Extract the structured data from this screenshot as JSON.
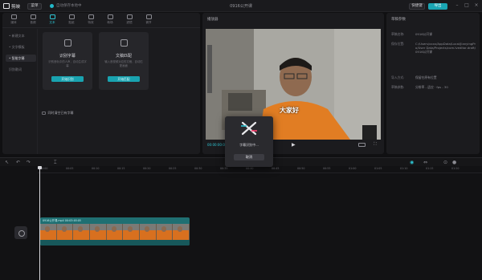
{
  "app": {
    "name": "剪映",
    "menu_label": "菜单",
    "autosave": "自动保存本地中",
    "project_title": "0916公开课",
    "shortcut_label": "快捷键",
    "export_label": "导出"
  },
  "toolbar": [
    {
      "label": "媒体",
      "icon": "media-icon"
    },
    {
      "label": "音频",
      "icon": "audio-icon"
    },
    {
      "label": "文本",
      "icon": "text-icon",
      "active": true
    },
    {
      "label": "贴纸",
      "icon": "sticker-icon"
    },
    {
      "label": "特效",
      "icon": "effect-icon"
    },
    {
      "label": "转场",
      "icon": "transition-icon"
    },
    {
      "label": "滤镜",
      "icon": "filter-icon"
    },
    {
      "label": "调节",
      "icon": "adjust-icon"
    }
  ],
  "side": [
    "• 新建文本",
    "• 文字模板",
    "• 智能字幕",
    "识别歌词"
  ],
  "cards": [
    {
      "title": "识别字幕",
      "desc": "识别音轨中的人声，自动生成字幕",
      "button": "开始识别"
    },
    {
      "title": "文稿匹配",
      "desc": "输入音视频对应的文稿，自动匹配画面",
      "button": "开始匹配"
    }
  ],
  "checkbox_label": "同时清空已有字幕",
  "player": {
    "title": "播放器",
    "time": "00:00:00:00 / 00:03:48:05",
    "subtitle": "大家好"
  },
  "props": {
    "title": "草稿参数",
    "rows": [
      {
        "k": "草稿名称:",
        "v": "0916公开课"
      },
      {
        "k": "保存位置:",
        "v": "C:/Users/xxxx/AppData/Local/JianyingPro/User Data/Projects/com.lveditor.draft/0916公开课"
      },
      {
        "k": "导入方式:",
        "v": "保留在原有位置"
      },
      {
        "k": "草稿参数:",
        "v": "分辨率 - 适应 · fps - 30"
      }
    ]
  },
  "modal": {
    "text": "字幕识别中...",
    "button": "取消"
  },
  "timeline": {
    "ruler": [
      "00:00",
      "00:05",
      "00:10",
      "00:15",
      "00:20",
      "00:25",
      "00:30",
      "00:35",
      "00:40",
      "00:45",
      "00:50",
      "00:55",
      "01:00",
      "01:05",
      "01:10",
      "01:15",
      "01:20"
    ],
    "clip_label": "0916公开课.mp4  00:03:48:05"
  },
  "colors": {
    "accent": "#1aa6b4",
    "bg": "#101012"
  }
}
